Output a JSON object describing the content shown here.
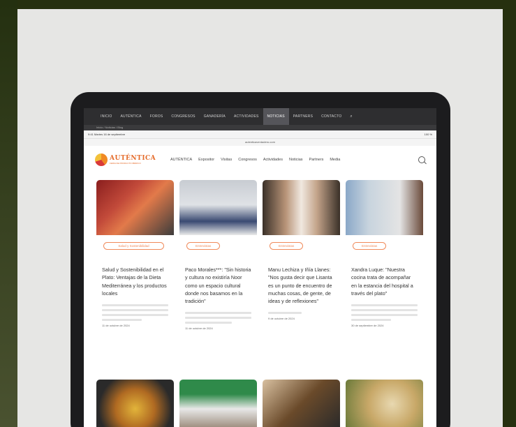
{
  "top_nav": {
    "items": [
      "INICIO",
      "AUTÉNTICA",
      "FOROS",
      "CONGRESOS",
      "GANADERÍA",
      "ACTIVIDADES",
      "NOTICIAS",
      "PARTNERS",
      "CONTACTO"
    ],
    "active": "NOTICIAS",
    "search_glyph": "⌕"
  },
  "breadcrumb": "Inicio / Noticias / Blog",
  "status_bar": {
    "time": "9:41",
    "date": "Martes 16 de septiembre",
    "battery": "100 %"
  },
  "url": "autenticaverdadero.com",
  "site_header": {
    "logo_title": "AUTÉNTICA",
    "logo_subtitle": "FERIA DE PRODUCTO IBÉRICO",
    "nav": [
      "AUTÉNTICA",
      "Expositor",
      "Visitas",
      "Congresos",
      "Actividades",
      "Noticias",
      "Partners",
      "Media"
    ]
  },
  "cards": [
    {
      "tag": "Salud y Sostenibilidad",
      "title": "Salud y Sostenibilidad en el Plato: Ventajas de la Dieta Mediterránea y los productos locales",
      "date": "11 de octubre de 2024"
    },
    {
      "tag": "Entrevistas",
      "title": "Paco Morales***: \"Sin historia y cultura no existiría Noor como un espacio cultural donde nos basamos en la tradición\"",
      "date": "11 de octubre de 2024"
    },
    {
      "tag": "Entrevistas",
      "title": "Manu Lechiza y Iñía Llanes: \"Nos gusta decir que Lisanta es un punto de encuentro de muchas cosas, de gente, de ideas y de reflexiones\"",
      "date": "9 de octubre de 2024"
    },
    {
      "tag": "Entrevistas",
      "title": "Xandra Luque: \"Nuestra cocina trata de acompañar en la estancia del hospital a través del plato\"",
      "date": "30 de septiembre de 2024"
    }
  ],
  "colors": {
    "accent": "#f08a5a",
    "dark_nav": "#2e2e30",
    "background": "#e6e6e4"
  }
}
